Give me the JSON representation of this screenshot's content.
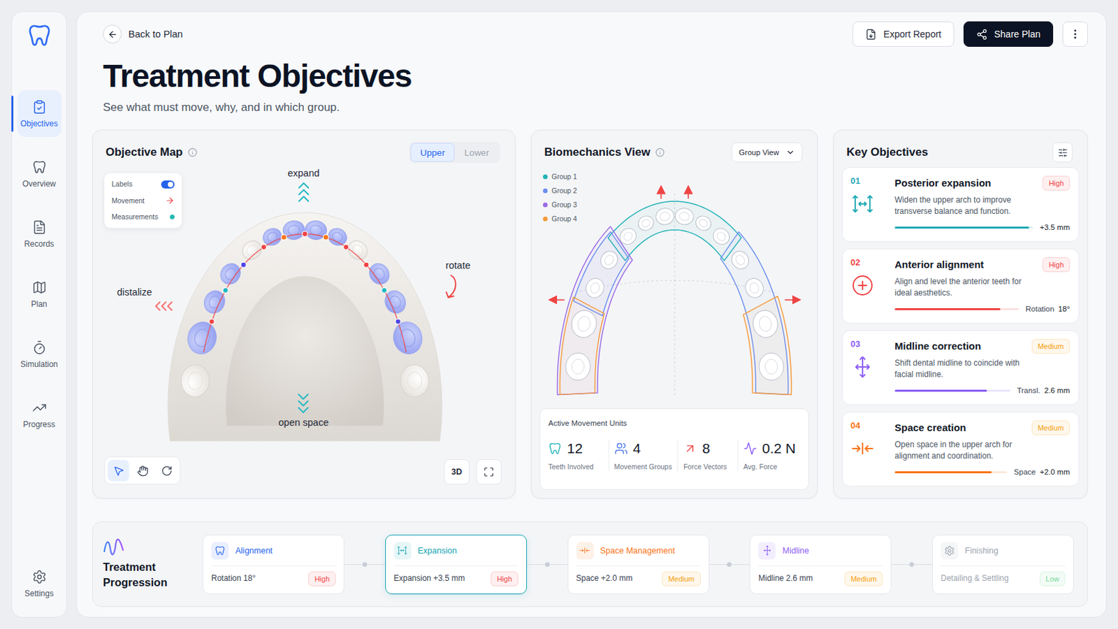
{
  "sidebar": {
    "items": [
      {
        "label": "Objectives",
        "selected": true
      },
      {
        "label": "Overview",
        "selected": false
      },
      {
        "label": "Records",
        "selected": false
      },
      {
        "label": "Plan",
        "selected": false
      },
      {
        "label": "Simulation",
        "selected": false
      },
      {
        "label": "Progress",
        "selected": false
      }
    ],
    "footer": {
      "label": "Settings",
      "selected": false
    }
  },
  "header": {
    "back": "Back to Plan",
    "export": "Export Report",
    "share": "Share Plan"
  },
  "page": {
    "title": "Treatment Objectives",
    "subtitle": "See what must move, why, and in which group."
  },
  "objective_map": {
    "title": "Objective Map",
    "tabs": [
      {
        "label": "Upper",
        "selected": true
      },
      {
        "label": "Lower",
        "selected": false
      }
    ],
    "legend": [
      {
        "label": "Labels",
        "kind": "toggle",
        "on": true,
        "color": "#2563eb"
      },
      {
        "label": "Movement",
        "kind": "arrow",
        "color": "#ef4444"
      },
      {
        "label": "Measurements",
        "kind": "dot",
        "color": "#22b8b0"
      }
    ],
    "annotations": [
      {
        "label": "expand",
        "kind": "up",
        "color": "#22b8c2"
      },
      {
        "label": "rotate",
        "kind": "curve",
        "color": "#ef4444"
      },
      {
        "label": "distalize",
        "kind": "left",
        "color": "#f87171"
      },
      {
        "label": "open space",
        "kind": "down",
        "color": "#22b8c2"
      }
    ],
    "teeth": [
      {
        "highlighted": false
      },
      {
        "highlighted": true
      },
      {
        "highlighted": true
      },
      {
        "highlighted": true
      },
      {
        "highlighted": false
      },
      {
        "highlighted": true
      },
      {
        "highlighted": true
      },
      {
        "highlighted": true
      },
      {
        "highlighted": true
      },
      {
        "highlighted": false
      },
      {
        "highlighted": true
      },
      {
        "highlighted": true
      },
      {
        "highlighted": true
      },
      {
        "highlighted": false
      }
    ],
    "tools": [
      {
        "kind": "select",
        "selected": true
      },
      {
        "kind": "pan",
        "selected": false
      },
      {
        "kind": "rotate",
        "selected": false
      }
    ],
    "view_toggle": "3D"
  },
  "biomechanics": {
    "title": "Biomechanics View",
    "view": "Group View",
    "groups": [
      {
        "label": "Group 1",
        "color": "#22b3b8"
      },
      {
        "label": "Group 2",
        "color": "#6b8ff0"
      },
      {
        "label": "Group 3",
        "color": "#9b6be6"
      },
      {
        "label": "Group 4",
        "color": "#f59a3c"
      }
    ],
    "units_title": "Active Movement Units",
    "units": [
      {
        "value": "12",
        "label": "Teeth Involved",
        "color": "#22b3b8"
      },
      {
        "value": "4",
        "label": "Movement Groups",
        "color": "#4f7ae8"
      },
      {
        "value": "8",
        "label": "Force Vectors",
        "color": "#ef4444"
      },
      {
        "value": "0.2 N",
        "label": "Avg. Force",
        "color": "#8b5cf6"
      }
    ]
  },
  "key_objectives": {
    "title": "Key Objectives",
    "items": [
      {
        "number": "01",
        "title": "Posterior expansion",
        "priority": "High",
        "priority_color": "#ef4444",
        "description": "Widen the upper arch to improve transverse balance and function.",
        "reading": "+3.5 mm",
        "level": 0.97,
        "color": "#1fa9b5"
      },
      {
        "number": "02",
        "title": "Anterior alignment",
        "priority": "High",
        "priority_color": "#ef4444",
        "description": "Align and level the anterior teeth for ideal aesthetics.",
        "reading_label": "Rotation",
        "reading": "18°",
        "level": 0.85,
        "color": "#ef4444"
      },
      {
        "number": "03",
        "title": "Midline correction",
        "priority": "Medium",
        "priority_color": "#f59e0b",
        "description": "Shift dental midline to coincide with facial midline.",
        "reading_label": "Transl.",
        "reading": "2.6 mm",
        "level": 0.8,
        "color": "#8b5cf6"
      },
      {
        "number": "04",
        "title": "Space creation",
        "priority": "Medium",
        "priority_color": "#f59e0b",
        "description": "Open space in the upper arch for alignment and coordination.",
        "reading_label": "Space",
        "reading": "+2.0 mm",
        "level": 0.86,
        "color": "#f97316"
      }
    ]
  },
  "progression": {
    "title": "Treatment Progression",
    "steps": [
      {
        "label": "Alignment",
        "detail": "Rotation 18°",
        "priority": "High",
        "priority_color": "#ef4444",
        "color": "#2563eb",
        "selected": false,
        "disabled": false
      },
      {
        "label": "Expansion",
        "detail": "Expansion +3.5 mm",
        "priority": "High",
        "priority_color": "#ef4444",
        "color": "#14a3b0",
        "selected": true,
        "disabled": false
      },
      {
        "label": "Space Management",
        "detail": "Space +2.0 mm",
        "priority": "Medium",
        "priority_color": "#f59e0b",
        "color": "#f97316",
        "selected": false,
        "disabled": false
      },
      {
        "label": "Midline",
        "detail": "Midline 2.6 mm",
        "priority": "Medium",
        "priority_color": "#f59e0b",
        "color": "#8b5cf6",
        "selected": false,
        "disabled": false
      },
      {
        "label": "Finishing",
        "detail": "Detailing & Settling",
        "priority": "Low",
        "priority_color": "#22c55e",
        "color": "#9ca3af",
        "selected": false,
        "disabled": true
      }
    ]
  }
}
